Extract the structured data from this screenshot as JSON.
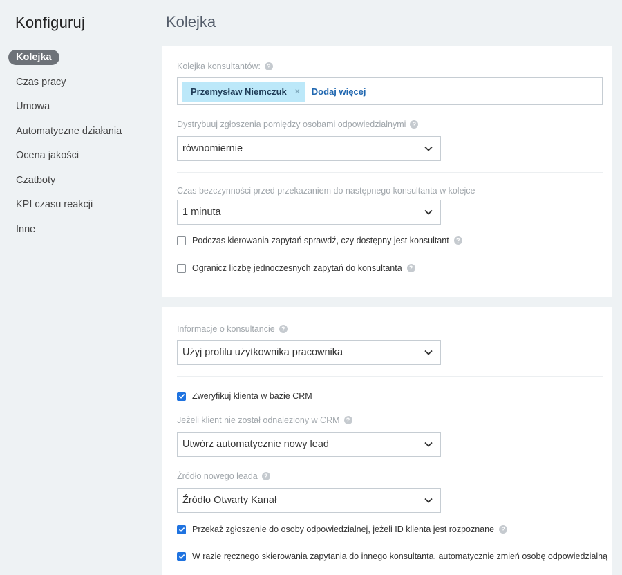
{
  "sidebar": {
    "title": "Konfiguruj",
    "items": [
      {
        "label": "Kolejka",
        "active": true
      },
      {
        "label": "Czas pracy"
      },
      {
        "label": "Umowa"
      },
      {
        "label": "Automatyczne działania"
      },
      {
        "label": "Ocena jakości"
      },
      {
        "label": "Czatboty"
      },
      {
        "label": "KPI czasu reakcji"
      },
      {
        "label": "Inne"
      }
    ]
  },
  "page": {
    "title": "Kolejka"
  },
  "queue": {
    "consultants_label": "Kolejka konsultantów:",
    "consultant_tag": "Przemysław Niemczuk",
    "remove_symbol": "×",
    "add_more": "Dodaj więcej",
    "distribute_label": "Dystrybuuj zgłoszenia pomiędzy osobami odpowiedzialnymi",
    "distribute_value": "równomiernie",
    "idle_label": "Czas bezczynności przed przekazaniem do następnego konsultanta w kolejce",
    "idle_value": "1 minuta",
    "check_available": {
      "label": "Podczas kierowania zapytań sprawdź, czy dostępny jest konsultant",
      "checked": false
    },
    "limit_requests": {
      "label": "Ogranicz liczbę jednoczesnych zapytań do konsultanta",
      "checked": false
    }
  },
  "consultant_info": {
    "info_label": "Informacje o konsultancie",
    "info_value": "Użyj profilu użytkownika pracownika",
    "verify_crm": {
      "label": "Zweryfikuj klienta w bazie CRM",
      "checked": true
    },
    "not_found_label": "Jeżeli klient nie został odnaleziony w CRM",
    "not_found_value": "Utwórz automatycznie nowy lead",
    "source_label": "Źródło nowego leada",
    "source_value": "Źródło Otwarty Kanał",
    "forward_responsible": {
      "label": "Przekaż zgłoszenie do osoby odpowiedzialnej, jeżeli ID klienta jest rozpoznane",
      "checked": true
    },
    "auto_change": {
      "label": "W razie ręcznego skierowania zapytania do innego konsultanta, automatycznie zmień osobę odpowiedzialną",
      "checked": true
    }
  },
  "help_symbol": "?",
  "colors": {
    "accent": "#1f73e0",
    "tag_bg": "#bce8f9",
    "active_nav": "#6d7278"
  }
}
